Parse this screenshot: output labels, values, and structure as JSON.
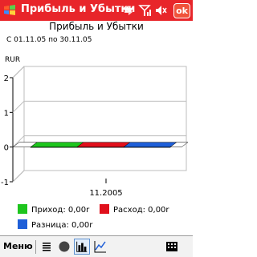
{
  "app": {
    "window_title": "Прибыль и Убытки",
    "ok_label": "ok"
  },
  "header": {
    "chart_title": "Прибыль и Убытки",
    "date_range": "С 01.11.05 по 30.11.05",
    "unit": "RUR"
  },
  "menubar": {
    "menu_label": "Меню"
  },
  "colors": {
    "titlebar": "#e8252a",
    "income": "#1ec51e",
    "expense": "#e0101c",
    "difference": "#1f5fd8"
  },
  "legend": [
    {
      "label": "Приход: 0,00r",
      "color": "#1ec51e"
    },
    {
      "label": "Расход: 0,00r",
      "color": "#e0101c"
    },
    {
      "label": "Разница: 0,00r",
      "color": "#1f5fd8"
    }
  ],
  "chart_data": {
    "type": "bar",
    "title": "Прибыль и Убытки",
    "ylabel": "RUR",
    "ylim": [
      -1,
      2
    ],
    "yticks": [
      -1,
      0,
      1,
      2
    ],
    "categories": [
      "11.2005"
    ],
    "series": [
      {
        "name": "Приход",
        "values": [
          0
        ]
      },
      {
        "name": "Расход",
        "values": [
          0
        ]
      },
      {
        "name": "Разница",
        "values": [
          0
        ]
      }
    ],
    "grid": true,
    "legend_position": "bottom"
  }
}
